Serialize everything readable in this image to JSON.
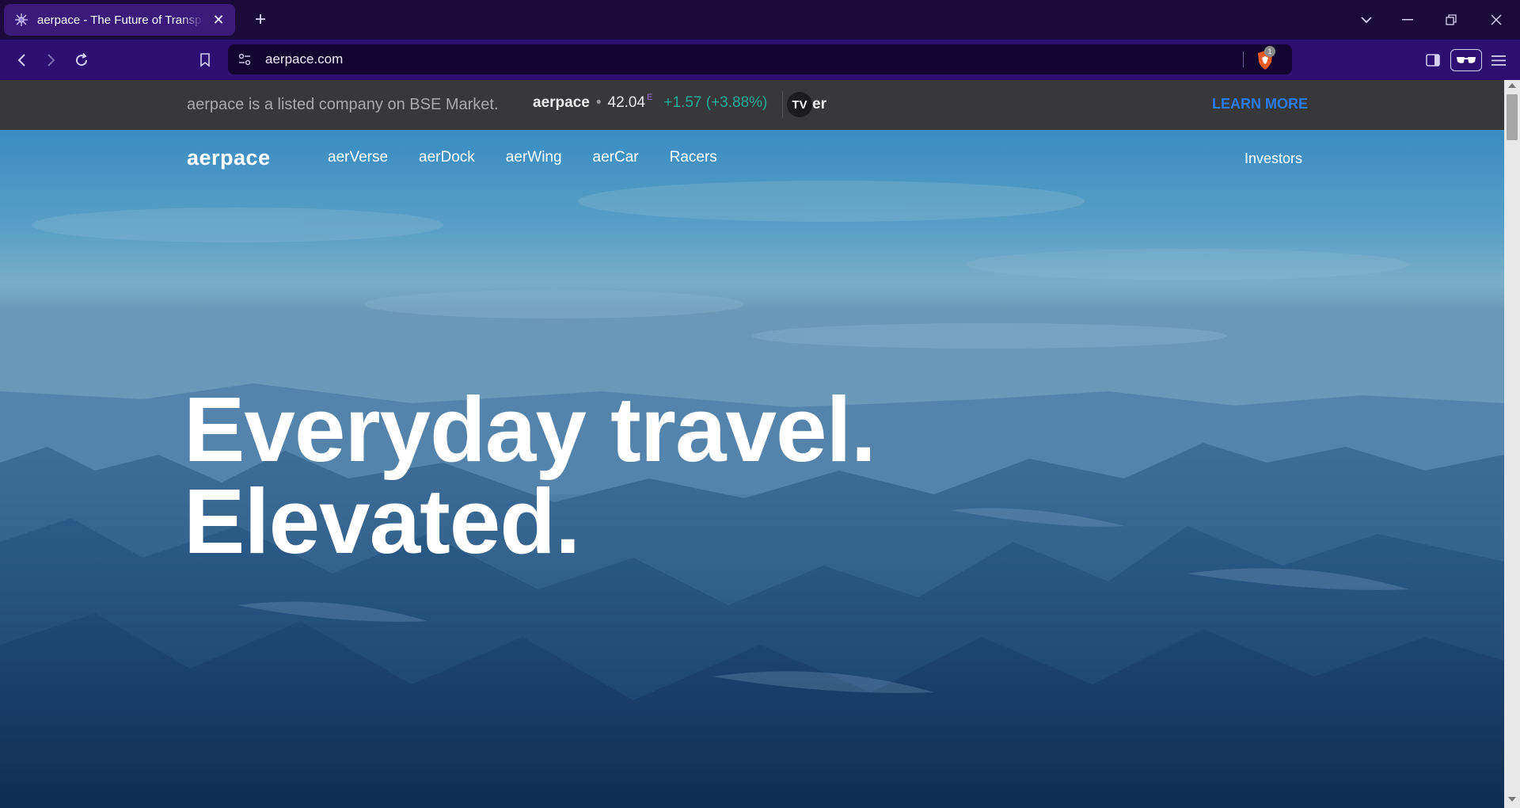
{
  "browser": {
    "tab_title": "aerpace - The Future of Transportation",
    "tab_close": "✕",
    "new_tab": "+",
    "url": "aerpace.com",
    "brave_badge_count": "1"
  },
  "announcement": {
    "text": "aerpace is a listed company on BSE Market.",
    "ticker_symbol": "aerpace",
    "ticker_dot": "•",
    "ticker_price": "42.04",
    "ticker_price_flag": "E",
    "ticker_change": "+1.57 (+3.88%)",
    "widget_logo": "TV",
    "widget_suffix": "er",
    "cta": "LEARN MORE",
    "colors": {
      "change": "#22ab94",
      "cta": "#2a7bf0"
    }
  },
  "site_nav": {
    "logo": "aerpace",
    "items": [
      "aerVerse",
      "aerDock",
      "aerWing",
      "aerCar",
      "Racers"
    ],
    "investors": "Investors"
  },
  "hero": {
    "headline_line1": "Everyday travel.",
    "headline_line2": "Elevated."
  }
}
